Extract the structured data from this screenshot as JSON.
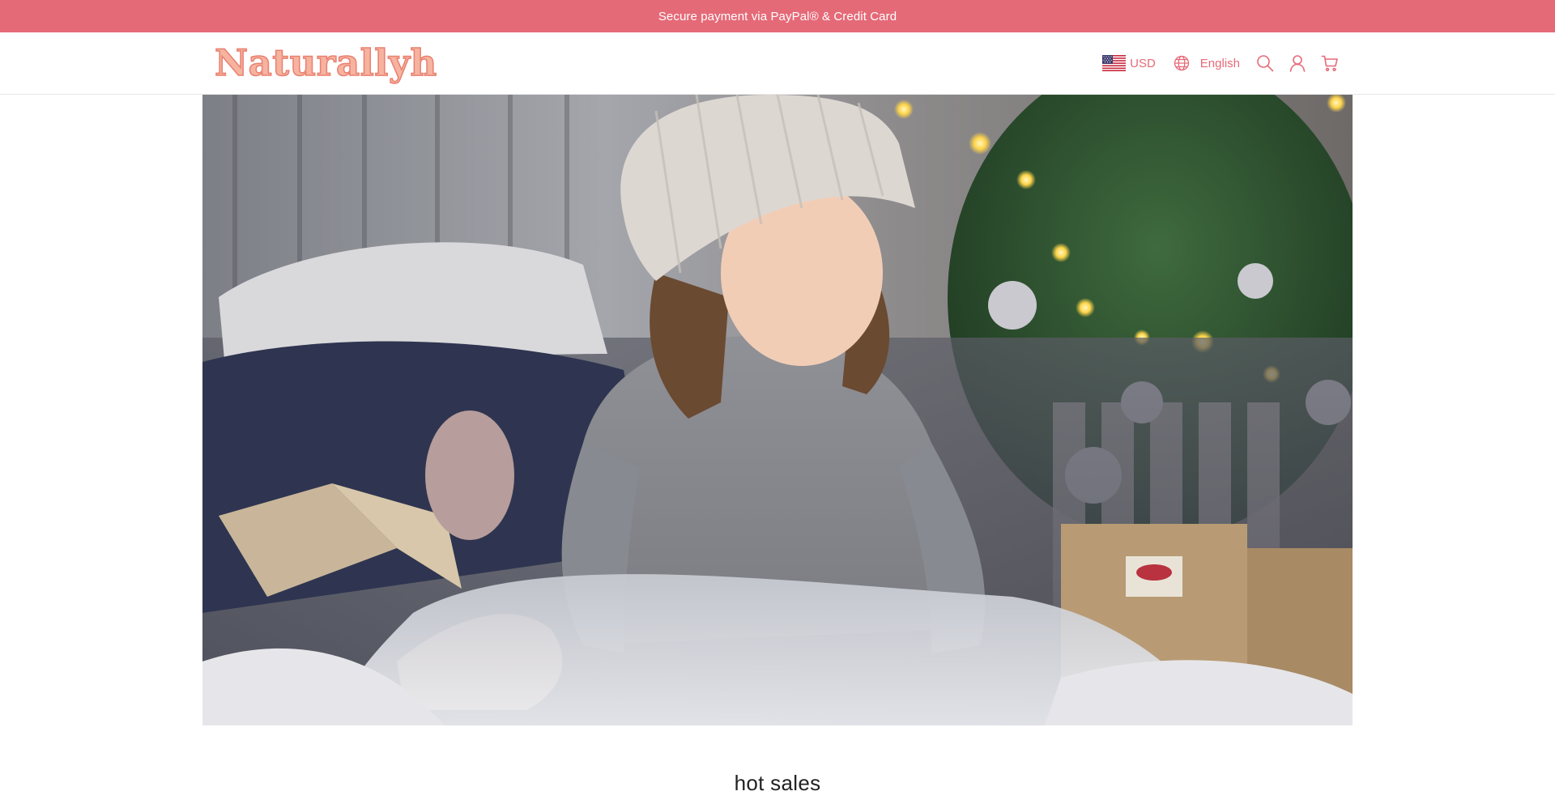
{
  "announcement": {
    "text": "Secure payment via PayPal® & Credit Card"
  },
  "header": {
    "logo_text": "Naturallyh",
    "currency": {
      "code": "USD",
      "flag_icon": "us-flag-icon"
    },
    "language": {
      "label": "English",
      "icon": "globe-icon"
    },
    "icons": [
      "search-icon",
      "account-icon",
      "cart-icon"
    ]
  },
  "hero": {
    "image_description": "girl-in-knit-hat-christmas-tree-photo"
  },
  "main": {
    "section_title": "hot sales"
  },
  "colors": {
    "brand_accent": "#e56a78",
    "logo_fill": "#f6b3a0",
    "logo_stroke": "#e9806f",
    "text_dark": "#222222"
  }
}
